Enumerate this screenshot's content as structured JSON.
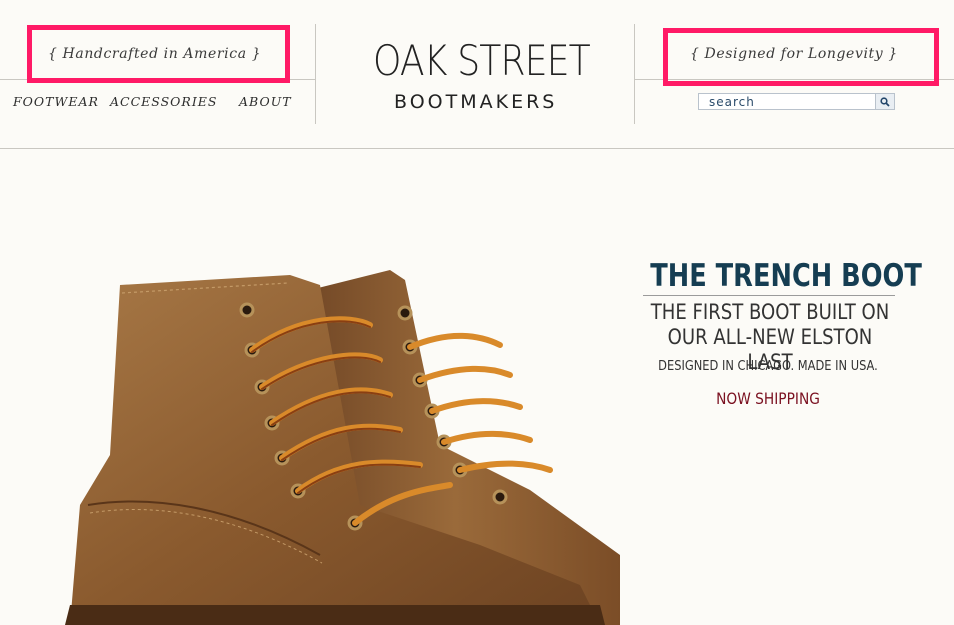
{
  "header": {
    "tagline_left": "{  Handcrafted in America  }",
    "tagline_right": "{  Designed for Longevity  }",
    "logo_main": "OAK STREET",
    "logo_sub": "BOOTMAKERS",
    "nav": [
      {
        "label": "FOOTWEAR"
      },
      {
        "label": "ACCESSORIES"
      },
      {
        "label": "ABOUT"
      }
    ],
    "search": {
      "placeholder": "search",
      "value": ""
    }
  },
  "hero": {
    "title": "THE TRENCH BOOT",
    "subtitle": "THE FIRST BOOT BUILT ON\nOUR ALL-NEW ELSTON LAST",
    "made": "DESIGNED IN CHICAGO. MADE IN USA.",
    "cta": "NOW SHIPPING"
  },
  "colors": {
    "background": "#fcfbf7",
    "highlight_box": "#ff1a66",
    "title": "#153d52",
    "cta": "#7a1020",
    "leather": "#8a5a2e"
  },
  "icons": {
    "search": "magnifier-icon"
  }
}
